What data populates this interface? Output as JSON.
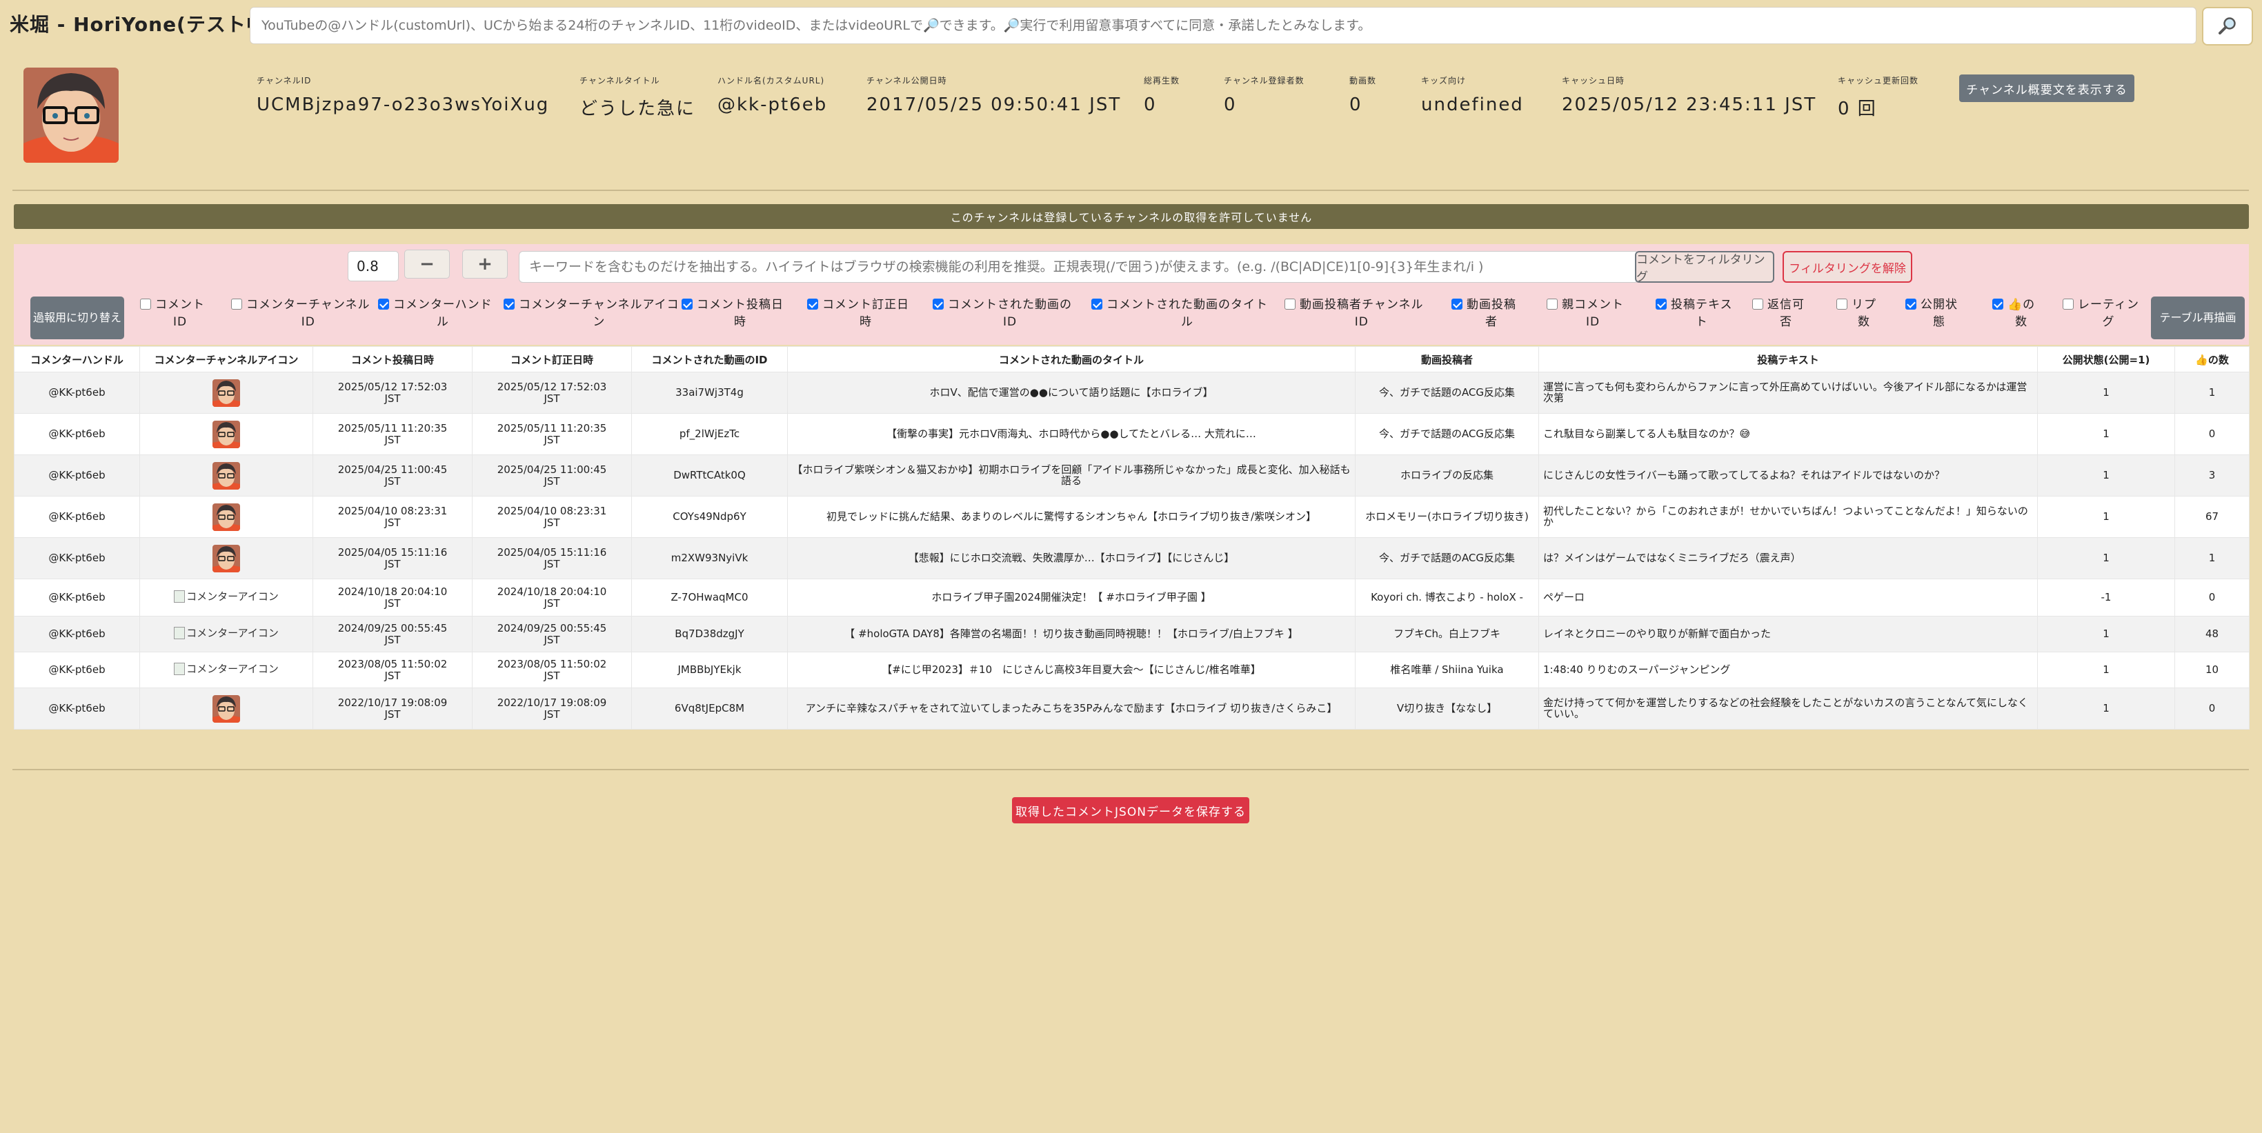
{
  "app": {
    "title": "米堀 - HoriYone(テスト中)",
    "search_placeholder": "YouTubeの@ハンドル(customUrl)、UCから始まる24桁のチャンネルID、11桁のvideoID、またはvideoURLで🔎できます。🔎実行で利用留意事項すべてに同意・承諾したとみなします。",
    "search_icon": "magnifier-icon"
  },
  "channel": {
    "stats": [
      {
        "label": "チャンネルID",
        "value": "UCMBjzpa97-o23o3wsYoiXug"
      },
      {
        "label": "チャンネルタイトル",
        "value": "どうした急に"
      },
      {
        "label": "ハンドル名(カスタムURL)",
        "value": "@kk-pt6eb"
      },
      {
        "label": "チャンネル公開日時",
        "value": "2017/05/25 09:50:41 JST"
      },
      {
        "label": "総再生数",
        "value": "0"
      },
      {
        "label": "チャンネル登録者数",
        "value": "0"
      },
      {
        "label": "動画数",
        "value": "0"
      },
      {
        "label": "キッズ向け",
        "value": "undefined"
      },
      {
        "label": "キャッシュ日時",
        "value": "2025/05/12 23:45:11 JST"
      },
      {
        "label": "キャッシュ更新回数",
        "value": "0 回"
      }
    ],
    "show_description_label": "チャンネル概要文を表示する"
  },
  "notice": "このチャンネルは登録しているチャンネルの取得を許可していません",
  "filter": {
    "rate_value": "0.8",
    "minus_label": "−",
    "plus_label": "+",
    "keyword_placeholder": "キーワードを含むものだけを抽出する。ハイライトはブラウザの検索機能の利用を推奨。正規表現(/で囲う)が使えます。(e.g. /(BC|AD|CE)1[0-9]{3}年生まれ/i )",
    "filter_button": "コメントをフィルタリング",
    "clear_button": "フィルタリングを解除",
    "mode_button": "過報用に切り替え",
    "redraw_button": "テーブル再描画",
    "columns": [
      {
        "label": "コメント\nID",
        "checked": false
      },
      {
        "label": "コメンターチャンネル\nID",
        "checked": false
      },
      {
        "label": "コメンターハンド\nル",
        "checked": true
      },
      {
        "label": "コメンターチャンネルアイコ\nン",
        "checked": true
      },
      {
        "label": "コメント投稿日\n時",
        "checked": true
      },
      {
        "label": "コメント訂正日\n時",
        "checked": true
      },
      {
        "label": "コメントされた動画の\nID",
        "checked": true
      },
      {
        "label": "コメントされた動画のタイト\nル",
        "checked": true
      },
      {
        "label": "動画投稿者チャンネル\nID",
        "checked": false
      },
      {
        "label": "動画投稿\n者",
        "checked": true
      },
      {
        "label": "親コメント\nID",
        "checked": false
      },
      {
        "label": "投稿テキス\nト",
        "checked": true
      },
      {
        "label": "返信可\n否",
        "checked": false
      },
      {
        "label": "リプ\n数",
        "checked": false
      },
      {
        "label": "公開状\n態",
        "checked": true
      },
      {
        "label": "👍の\n数",
        "checked": true
      },
      {
        "label": "レーティン\nグ",
        "checked": false
      }
    ]
  },
  "table": {
    "headers": [
      "コメンターハンドル",
      "コメンターチャンネルアイコン",
      "コメント投稿日時",
      "コメント訂正日時",
      "コメントされた動画のID",
      "コメントされた動画のタイトル",
      "動画投稿者",
      "投稿テキスト",
      "公開状態(公開=1)",
      "👍の数"
    ],
    "broken_icon_alt": "コメンターアイコン",
    "rows": [
      {
        "handle": "@KK-pt6eb",
        "icon": "avatar",
        "posted": "2025/05/12 17:52:03\nJST",
        "edited": "2025/05/12 17:52:03\nJST",
        "video_id": "33ai7Wj3T4g",
        "video_title": "ホロV、配信で運営の●●について語り話題に【ホロライブ】",
        "uploader": "今、ガチで話題のACG反応集",
        "text": "運営に言っても何も変わらんからファンに言って外圧高めていけばいい。今後アイドル部になるかは運営次第",
        "public": "1",
        "likes": "1"
      },
      {
        "handle": "@KK-pt6eb",
        "icon": "avatar",
        "posted": "2025/05/11 11:20:35\nJST",
        "edited": "2025/05/11 11:20:35\nJST",
        "video_id": "pf_2lWjEzTc",
        "video_title": "【衝撃の事実】元ホロV雨海丸、ホロ時代から●●してたとバレる… 大荒れに…",
        "uploader": "今、ガチで話題のACG反応集",
        "text": "これ駄目なら副業してる人も駄目なのか？😅",
        "public": "1",
        "likes": "0"
      },
      {
        "handle": "@KK-pt6eb",
        "icon": "avatar",
        "posted": "2025/04/25 11:00:45\nJST",
        "edited": "2025/04/25 11:00:45\nJST",
        "video_id": "DwRTtCAtk0Q",
        "video_title": "【ホロライブ紫咲シオン＆猫又おかゆ】初期ホロライブを回顧「アイドル事務所じゃなかった」成長と変化、加入秘話も語る",
        "uploader": "ホロライブの反応集",
        "text": "にじさんじの女性ライバーも踊って歌ってしてるよね？それはアイドルではないのか？",
        "public": "1",
        "likes": "3"
      },
      {
        "handle": "@KK-pt6eb",
        "icon": "avatar",
        "posted": "2025/04/10 08:23:31\nJST",
        "edited": "2025/04/10 08:23:31\nJST",
        "video_id": "COYs49Ndp6Y",
        "video_title": "初見でレッドに挑んだ結果、あまりのレベルに驚愕するシオンちゃん【ホロライブ切り抜き/紫咲シオン】",
        "uploader": "ホロメモリー(ホロライブ切り抜き)",
        "text": "初代したことない？から「このおれさまが！せかいでいちばん！つよいってことなんだよ！」知らないのか",
        "public": "1",
        "likes": "67"
      },
      {
        "handle": "@KK-pt6eb",
        "icon": "avatar",
        "posted": "2025/04/05 15:11:16\nJST",
        "edited": "2025/04/05 15:11:16\nJST",
        "video_id": "m2XW93NyiVk",
        "video_title": "【悲報】にじホロ交流戦、失敗濃厚か…【ホロライブ】【にじさんじ】",
        "uploader": "今、ガチで話題のACG反応集",
        "text": "は？メインはゲームではなくミニライブだろ（震え声）",
        "public": "1",
        "likes": "1"
      },
      {
        "handle": "@KK-pt6eb",
        "icon": "broken",
        "posted": "2024/10/18 20:04:10\nJST",
        "edited": "2024/10/18 20:04:10\nJST",
        "video_id": "Z-7OHwaqMC0",
        "video_title": "ホロライブ甲子園2024開催決定！【 #ホロライブ甲子園 】",
        "uploader": "Koyori ch. 博衣こより - holoX -",
        "text": "ペゲーロ",
        "public": "-1",
        "likes": "0"
      },
      {
        "handle": "@KK-pt6eb",
        "icon": "broken",
        "posted": "2024/09/25 00:55:45\nJST",
        "edited": "2024/09/25 00:55:45\nJST",
        "video_id": "Bq7D38dzgJY",
        "video_title": "【 #holoGTA DAY8】各陣営の名場面！！切り抜き動画同時視聴！！【ホロライブ/白上フブキ 】",
        "uploader": "フブキCh。白上フブキ",
        "text": "レイネとクロニーのやり取りが新鮮で面白かった",
        "public": "1",
        "likes": "48"
      },
      {
        "handle": "@KK-pt6eb",
        "icon": "broken",
        "posted": "2023/08/05 11:50:02\nJST",
        "edited": "2023/08/05 11:50:02\nJST",
        "video_id": "JMBBbJYEkjk",
        "video_title": "【#にじ甲2023】＃10　にじさんじ高校3年目夏大会～【にじさんじ/椎名唯華】",
        "uploader": "椎名唯華 / Shiina Yuika",
        "text": "1:48:40 りりむのスーパージャンピング",
        "public": "1",
        "likes": "10"
      },
      {
        "handle": "@KK-pt6eb",
        "icon": "avatar",
        "posted": "2022/10/17 19:08:09\nJST",
        "edited": "2022/10/17 19:08:09\nJST",
        "video_id": "6Vq8tJEpC8M",
        "video_title": "アンチに辛辣なスパチャをされて泣いてしまったみこちを35Pみんなで励ます【ホロライブ 切り抜き/さくらみこ】",
        "uploader": "V切り抜き【ななし】",
        "text": "金だけ持ってて何かを運営したりするなどの社会経験をしたことがないカスの言うことなんて気にしなくていい。",
        "public": "1",
        "likes": "0"
      }
    ]
  },
  "save_button": "取得したコメントJSONデータを保存する",
  "colors": {
    "background": "#ecdcb0",
    "notice_bg": "#6f6a45",
    "filter_bg": "#f8d7da",
    "danger": "#dc3545",
    "secondary": "#6c757d",
    "checkbox": "#0d6efd"
  }
}
